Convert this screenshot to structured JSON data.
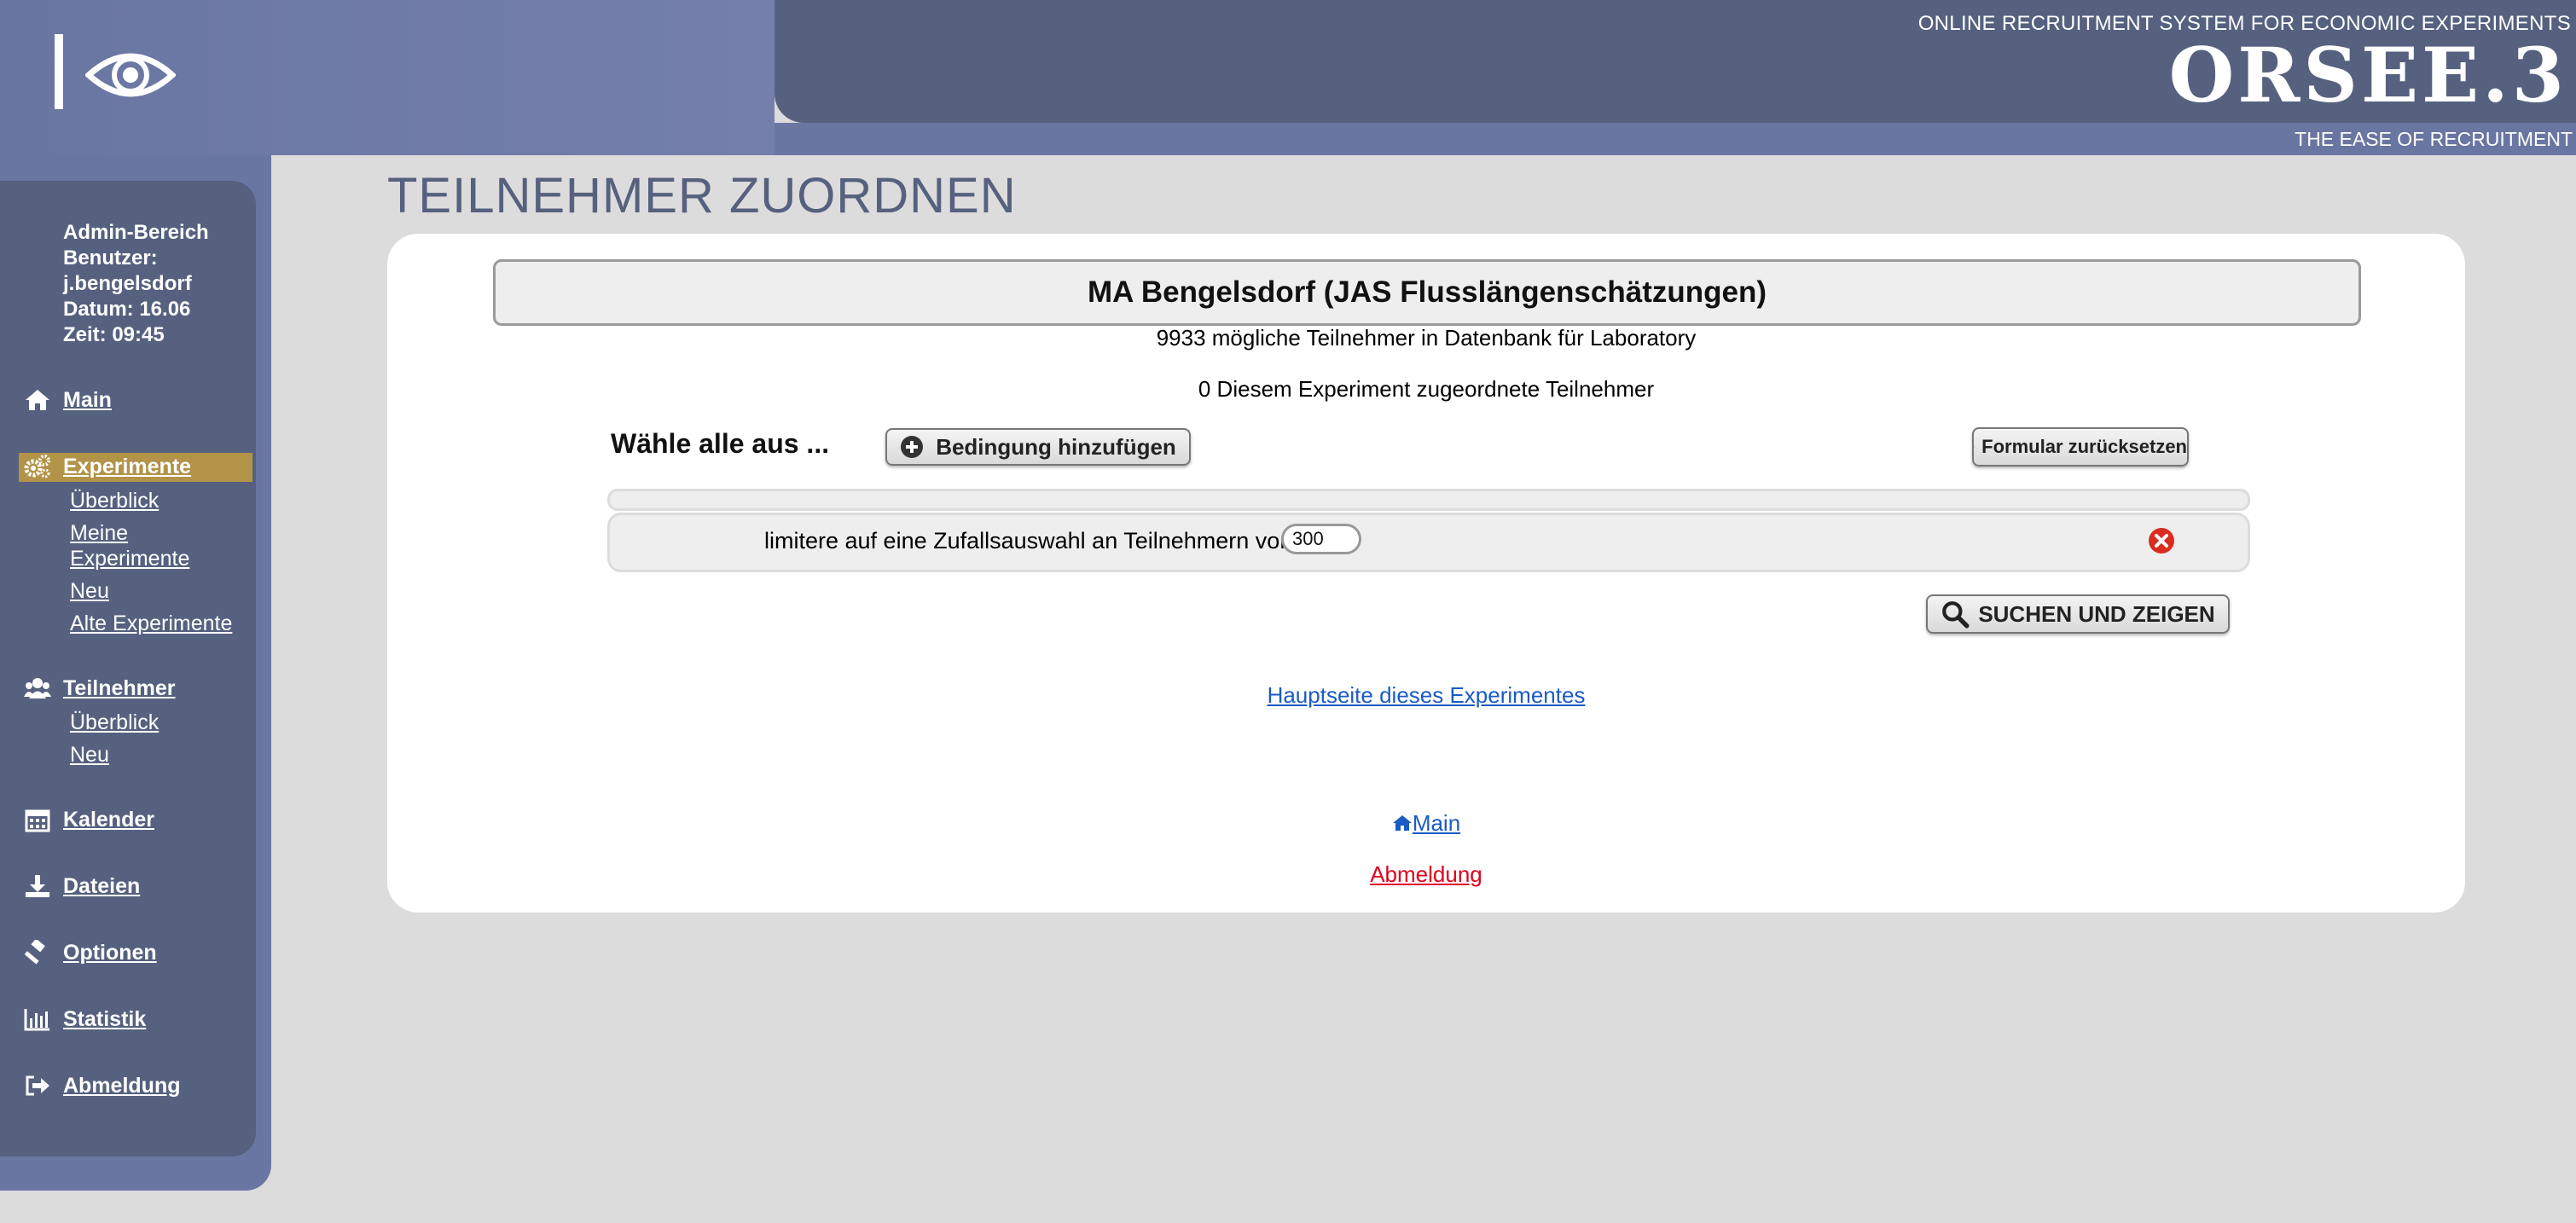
{
  "header": {
    "tagline_top": "ONLINE RECRUITMENT SYSTEM FOR ECONOMIC EXPERIMENTS",
    "brand": "ORSEE.3",
    "tagline_bottom": "THE EASE OF RECRUITMENT"
  },
  "sidebar": {
    "admin_area": "Admin-Bereich",
    "user_label": "Benutzer:",
    "username": "j.bengelsdorf",
    "date": "Datum: 16.06",
    "time": "Zeit: 09:45",
    "items": [
      {
        "label": "Main",
        "icon": "home-icon"
      },
      {
        "label": "Experimente",
        "icon": "gears-icon",
        "active": true,
        "subitems": [
          "Überblick",
          "Meine Experimente",
          "Neu",
          "Alte Experimente"
        ]
      },
      {
        "label": "Teilnehmer",
        "icon": "users-icon",
        "subitems": [
          "Überblick",
          "Neu"
        ]
      },
      {
        "label": "Kalender",
        "icon": "calendar-icon"
      },
      {
        "label": "Dateien",
        "icon": "download-icon"
      },
      {
        "label": "Optionen",
        "icon": "gavel-icon"
      },
      {
        "label": "Statistik",
        "icon": "bar-chart-icon"
      },
      {
        "label": "Abmeldung",
        "icon": "sign-out-icon"
      }
    ],
    "active_color": "#b29348"
  },
  "main": {
    "page_title": "TEILNEHMER ZUORDNEN",
    "experiment_title": "MA Bengelsdorf (JAS Flusslängenschätzungen)",
    "possible_participants": "9933 mögliche Teilnehmer in Datenbank für Laboratory",
    "assigned_participants": "0 Diesem Experiment zugeordnete Teilnehmer",
    "select_all": "Wähle alle aus ...",
    "add_condition_label": "Bedingung hinzufügen",
    "reset_form_label": "Formular zurücksetzen",
    "limit_label": "limitere auf eine Zufallsauswahl an Teilnehmern von",
    "limit_value": "300",
    "search_show_label": "SUCHEN UND ZEIGEN",
    "experiment_main_link": "Hauptseite dieses Experimentes",
    "main_link": "Main",
    "logout_link": "Abmeldung"
  },
  "colors": {
    "header_dark": "#56617f",
    "header_light": "#6a76a2",
    "link_blue": "#1a5bc4",
    "logout_red": "#e0001b"
  }
}
